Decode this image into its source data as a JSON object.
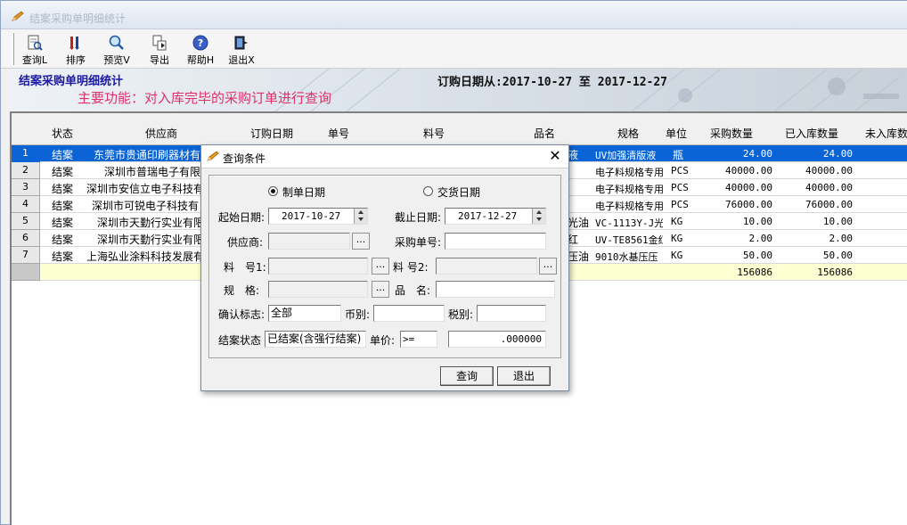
{
  "window": {
    "title": "结案采购单明细统计",
    "icon": "app-pencil-icon"
  },
  "toolbar": {
    "buttons": [
      {
        "label": "查询L",
        "icon": "query-icon"
      },
      {
        "label": "排序",
        "icon": "sort-icon"
      },
      {
        "label": "预览V",
        "icon": "preview-magnifier-icon"
      },
      {
        "label": "导出",
        "icon": "export-icon"
      },
      {
        "label": "帮助H",
        "icon": "help-icon"
      },
      {
        "label": "退出X",
        "icon": "exit-icon"
      }
    ]
  },
  "banner": {
    "report_title": "结案采购单明细统计",
    "function_text": "主要功能：对入库完毕的采购订单进行查询",
    "date_range": "订购日期从:2017-10-27 至 2017-12-27"
  },
  "grid": {
    "headers": [
      "状态",
      "供应商",
      "订购日期",
      "单号",
      "料号",
      "品名",
      "规格",
      "单位",
      "采购数量",
      "已入库数量",
      "未入库数"
    ],
    "rows": [
      {
        "no": "1",
        "status": "结案",
        "supplier": "东莞市贵通印刷器材有限",
        "name": "液",
        "spec": "UV加强清版液",
        "unit": "瓶",
        "qty": "24.00",
        "received": "24.00"
      },
      {
        "no": "2",
        "status": "结案",
        "supplier": "深圳市普瑞电子有限",
        "name": "",
        "spec": "电子料规格专用",
        "unit": "PCS",
        "qty": "40000.00",
        "received": "40000.00"
      },
      {
        "no": "3",
        "status": "结案",
        "supplier": "深圳市安信立电子科技有",
        "name": "",
        "spec": "电子料规格专用",
        "unit": "PCS",
        "qty": "40000.00",
        "received": "40000.00"
      },
      {
        "no": "4",
        "status": "结案",
        "supplier": "深圳市可锐电子科技有",
        "name": "",
        "spec": "电子料规格专用",
        "unit": "PCS",
        "qty": "76000.00",
        "received": "76000.00"
      },
      {
        "no": "5",
        "status": "结案",
        "supplier": "深圳市天勤行实业有限",
        "name": "光油",
        "spec": "VC-1113Y-J光油",
        "unit": "KG",
        "qty": "10.00",
        "received": "10.00"
      },
      {
        "no": "6",
        "status": "结案",
        "supplier": "深圳市天勤行实业有限",
        "name": "红",
        "spec": "UV-TE8561金红",
        "unit": "KG",
        "qty": "2.00",
        "received": "2.00"
      },
      {
        "no": "7",
        "status": "结案",
        "supplier": "上海弘业涂料科技发展有",
        "name": "压油",
        "spec": "9010水基压压",
        "unit": "KG",
        "qty": "50.00",
        "received": "50.00"
      }
    ],
    "totals": {
      "qty": "156086",
      "received": "156086"
    }
  },
  "dialog": {
    "title": "查询条件",
    "radio_make_date": "制单日期",
    "radio_delivery_date": "交货日期",
    "start_date_label": "起始日期:",
    "start_date": "2017-10-27",
    "end_date_label": "截止日期:",
    "end_date": "2017-12-27",
    "supplier_label": "供应商:",
    "po_label": "采购单号:",
    "part1_label": "料　号1:",
    "part2_label": "料 号2:",
    "spec_label": "规　格:",
    "name_label": "品　名:",
    "confirm_label": "确认标志:",
    "confirm_value": "全部",
    "currency_label": "币别:",
    "tax_label": "税别:",
    "closed_label": "结案状态",
    "closed_value": "已结案(含强行结案)",
    "price_label": "单价:",
    "price_op": ">=",
    "price_value": ".000000",
    "ellipsis": "...",
    "query_button": "查询",
    "exit_button": "退出"
  }
}
